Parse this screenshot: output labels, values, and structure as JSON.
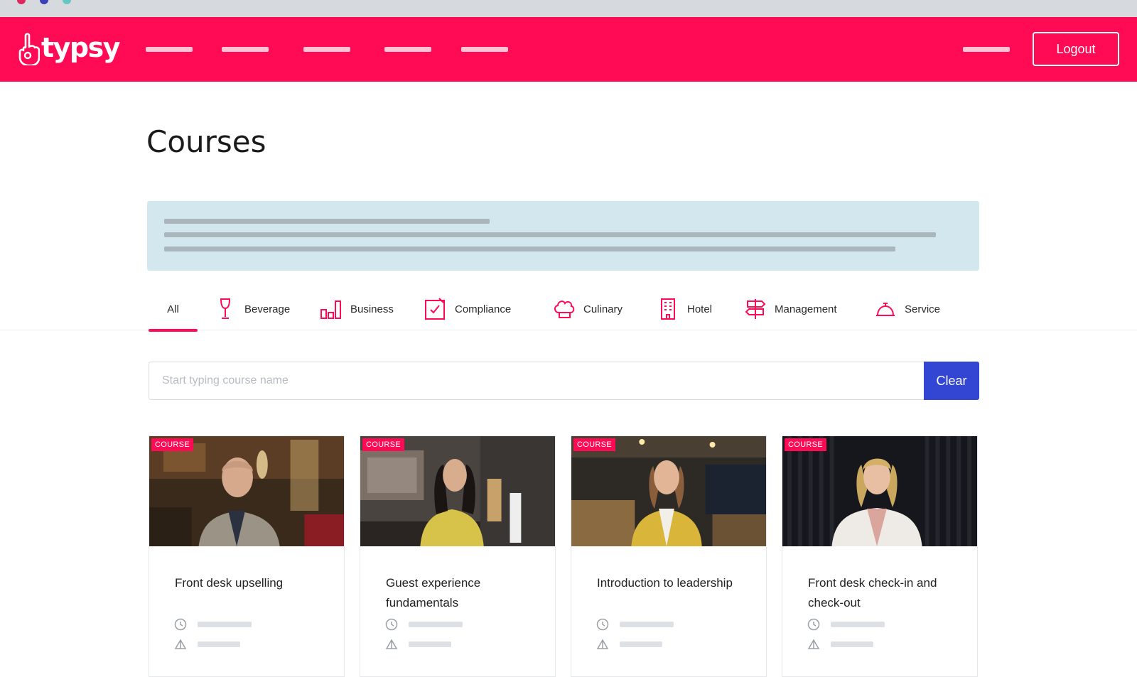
{
  "brand": {
    "name": "typsy",
    "color": "#ff0a54"
  },
  "header": {
    "logout_label": "Logout"
  },
  "page": {
    "title": "Courses"
  },
  "tabs": [
    {
      "label": "All",
      "icon": "none",
      "active": true
    },
    {
      "label": "Beverage",
      "icon": "wine-glass-icon"
    },
    {
      "label": "Business",
      "icon": "bar-chart-icon"
    },
    {
      "label": "Compliance",
      "icon": "checkbox-icon"
    },
    {
      "label": "Culinary",
      "icon": "chef-hat-icon"
    },
    {
      "label": "Hotel",
      "icon": "hotel-building-icon"
    },
    {
      "label": "Management",
      "icon": "signpost-icon"
    },
    {
      "label": "Service",
      "icon": "service-bell-icon"
    }
  ],
  "search": {
    "placeholder": "Start typing course name",
    "clear_label": "Clear",
    "clear_color": "#3346d3"
  },
  "courses": [
    {
      "badge": "COURSE",
      "title": "Front desk upselling",
      "thumbnail": "man-in-hotel-lobby"
    },
    {
      "badge": "COURSE",
      "title": "Guest experience fundamentals",
      "thumbnail": "woman-in-yellow-jacket-restaurant"
    },
    {
      "badge": "COURSE",
      "title": "Introduction to leadership",
      "thumbnail": "woman-in-yellow-blazer-bar"
    },
    {
      "badge": "COURSE",
      "title": "Front desk check-in and check-out",
      "thumbnail": "woman-in-white-blazer-dark-curtain"
    }
  ]
}
